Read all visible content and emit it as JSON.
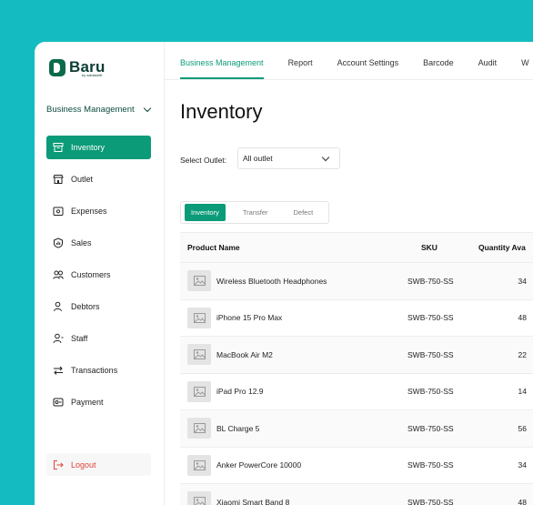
{
  "brand": {
    "name": "Baru",
    "tagline": "by sabiashift"
  },
  "sidebar": {
    "business_selector": "Business Management",
    "items": [
      {
        "label": "Inventory",
        "icon": "box-icon",
        "active": true
      },
      {
        "label": "Outlet",
        "icon": "store-icon",
        "active": false
      },
      {
        "label": "Expenses",
        "icon": "wallet-icon",
        "active": false
      },
      {
        "label": "Sales",
        "icon": "sales-icon",
        "active": false
      },
      {
        "label": "Customers",
        "icon": "users-icon",
        "active": false
      },
      {
        "label": "Debtors",
        "icon": "user-icon",
        "active": false
      },
      {
        "label": "Staff",
        "icon": "staff-icon",
        "active": false
      },
      {
        "label": "Transactions",
        "icon": "transfer-arrows-icon",
        "active": false
      },
      {
        "label": "Payment",
        "icon": "payment-icon",
        "active": false
      }
    ],
    "logout": "Logout"
  },
  "topnav": {
    "tabs": [
      {
        "label": "Business Management",
        "active": true
      },
      {
        "label": "Report",
        "active": false
      },
      {
        "label": "Account Settings",
        "active": false
      },
      {
        "label": "Barcode",
        "active": false
      },
      {
        "label": "Audit",
        "active": false
      },
      {
        "label": "W",
        "active": false
      }
    ]
  },
  "main": {
    "title": "Inventory",
    "outlet_label": "Select Outlet:",
    "outlet_value": "All outlet",
    "segments": [
      "Inventory",
      "Transfer",
      "Defect"
    ],
    "table": {
      "headers": {
        "name": "Product Name",
        "sku": "SKU",
        "qty": "Quantity Ava"
      },
      "rows": [
        {
          "name": "Wireless Bluetooth Headphones",
          "sku": "SWB-750-SS",
          "qty": "34"
        },
        {
          "name": "iPhone 15 Pro Max",
          "sku": "SWB-750-SS",
          "qty": "48"
        },
        {
          "name": "MacBook Air M2",
          "sku": "SWB-750-SS",
          "qty": "22"
        },
        {
          "name": "iPad Pro 12.9",
          "sku": "SWB-750-SS",
          "qty": "14"
        },
        {
          "name": "BL Charge 5",
          "sku": "SWB-750-SS",
          "qty": "56"
        },
        {
          "name": "Anker PowerCore 10000",
          "sku": "SWB-750-SS",
          "qty": "34"
        },
        {
          "name": "Xiaomi Smart Band 8",
          "sku": "SWB-750-SS",
          "qty": "48"
        }
      ]
    }
  },
  "colors": {
    "accent": "#0c9b78",
    "background": "#14bcc1",
    "danger": "#e0443a"
  }
}
